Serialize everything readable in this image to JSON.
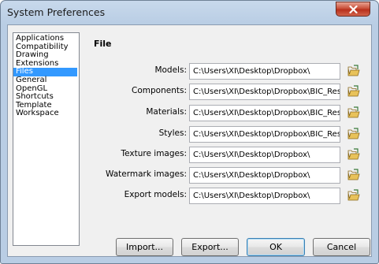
{
  "window": {
    "title": "System Preferences",
    "close_label": "close"
  },
  "sidebar": {
    "items": [
      {
        "label": "Applications",
        "selected": false
      },
      {
        "label": "Compatibility",
        "selected": false
      },
      {
        "label": "Drawing",
        "selected": false
      },
      {
        "label": "Extensions",
        "selected": false
      },
      {
        "label": "Files",
        "selected": true
      },
      {
        "label": "General",
        "selected": false
      },
      {
        "label": "OpenGL",
        "selected": false
      },
      {
        "label": "Shortcuts",
        "selected": false
      },
      {
        "label": "Template",
        "selected": false
      },
      {
        "label": "Workspace",
        "selected": false
      }
    ]
  },
  "panel": {
    "title": "File",
    "rows": [
      {
        "label": "Models:",
        "value": "C:\\Users\\XI\\Desktop\\Dropbox\\"
      },
      {
        "label": "Components:",
        "value": "C:\\Users\\XI\\Desktop\\Dropbox\\BIC_Res"
      },
      {
        "label": "Materials:",
        "value": "C:\\Users\\XI\\Desktop\\Dropbox\\BIC_Res"
      },
      {
        "label": "Styles:",
        "value": "C:\\Users\\XI\\Desktop\\Dropbox\\BIC_Res"
      },
      {
        "label": "Texture images:",
        "value": "C:\\Users\\XI\\Desktop\\Dropbox\\"
      },
      {
        "label": "Watermark images:",
        "value": "C:\\Users\\XI\\Desktop\\Dropbox\\"
      },
      {
        "label": "Export models:",
        "value": "C:\\Users\\XI\\Desktop\\Dropbox\\"
      }
    ]
  },
  "buttons": {
    "import": "Import...",
    "export": "Export...",
    "ok": "OK",
    "cancel": "Cancel"
  },
  "icons": {
    "close": "close-x-icon",
    "browse": "folder-browse-icon"
  },
  "colors": {
    "selection": "#3399ff",
    "close_button": "#c9503a",
    "title_bar": "#b9cde4"
  }
}
